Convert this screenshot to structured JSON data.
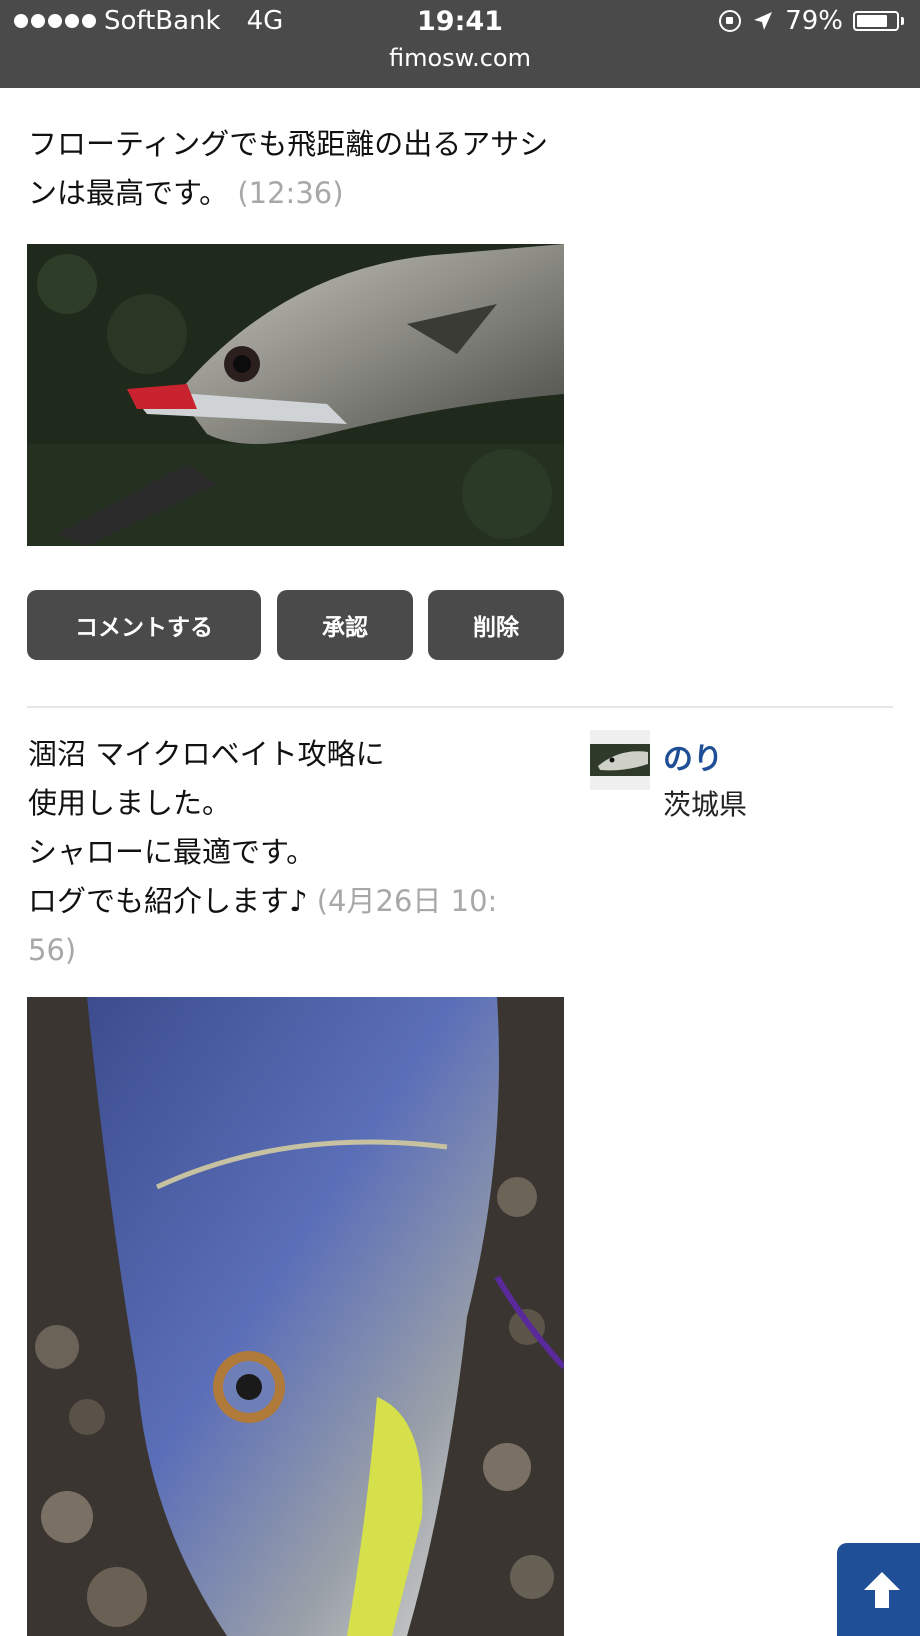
{
  "status_bar": {
    "carrier": "SoftBank",
    "network": "4G",
    "time": "19:41",
    "battery": "79%",
    "battery_level": 0.79,
    "url": "fimosw.com",
    "icons": [
      "signal-dots-icon",
      "orientation-lock-icon",
      "location-arrow-icon",
      "battery-icon"
    ]
  },
  "posts": [
    {
      "text": "フローティングでも飛距離の出るアサシンは最高です。",
      "timestamp": "(12:36)",
      "actions": {
        "comment": "コメントする",
        "approve": "承認",
        "delete": "削除"
      }
    },
    {
      "lines": [
        "涸沼 マイクロベイト攻略に",
        "使用しました。",
        "シャローに最適です。",
        "ログでも紹介します♪"
      ],
      "timestamp_part1": "(4月26日 10:",
      "timestamp_part2": "56)",
      "user": {
        "name": "のり",
        "location": "茨城県"
      }
    }
  ],
  "scroll_top": {
    "icon": "arrow-up-icon",
    "color": "#1f4f96"
  }
}
